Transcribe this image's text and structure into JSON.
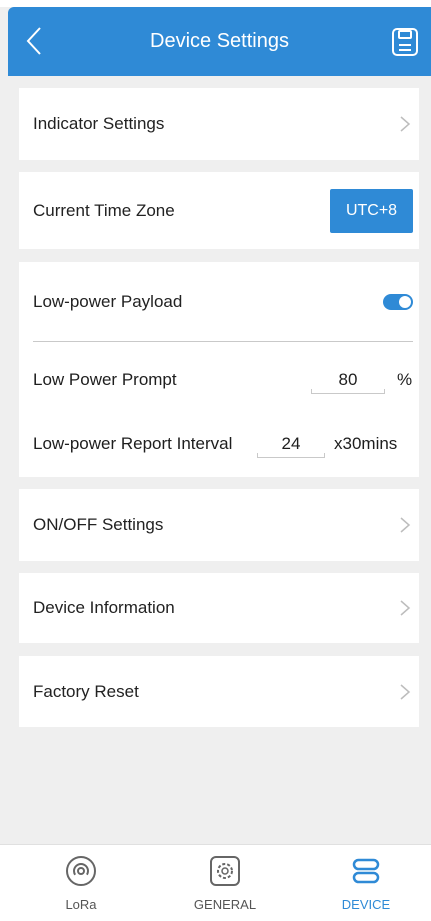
{
  "header": {
    "title": "Device Settings",
    "back_icon": "chevron-left-icon",
    "save_icon": "save-icon"
  },
  "indicator": {
    "label": "Indicator Settings"
  },
  "timezone": {
    "label": "Current Time Zone",
    "value": "UTC+8"
  },
  "low_power": {
    "payload_label": "Low-power Payload",
    "payload_enabled": true,
    "prompt_label": "Low Power Prompt",
    "prompt_value": "80",
    "prompt_unit": "%",
    "interval_label": "Low-power Report Interval",
    "interval_value": "24",
    "interval_unit": "x30mins"
  },
  "onoff": {
    "label": "ON/OFF Settings"
  },
  "device_info": {
    "label": "Device Information"
  },
  "factory_reset": {
    "label": "Factory Reset"
  },
  "nav": {
    "items": [
      {
        "label": "LoRa",
        "icon": "signal-icon",
        "active": false
      },
      {
        "label": "GENERAL",
        "icon": "gear-icon",
        "active": false
      },
      {
        "label": "DEVICE",
        "icon": "toggles-icon",
        "active": true
      }
    ]
  },
  "colors": {
    "accent": "#2f8ad6",
    "background": "#efefef",
    "card": "#ffffff"
  }
}
